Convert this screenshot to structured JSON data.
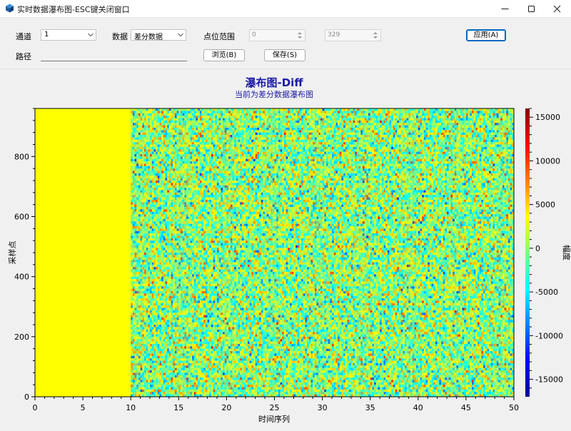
{
  "window": {
    "title": "实时数据瀑布图-ESC键关闭窗口"
  },
  "controls": {
    "channel_label": "通道",
    "channel_value": "1",
    "data_label": "数据",
    "data_value": "差分数据",
    "range_label": "点位范围",
    "range_start": "0",
    "range_end": "329",
    "apply_label": "应用(A)",
    "path_label": "路径",
    "path_value": "",
    "browse_label": "浏览(B)",
    "save_label": "保存(S)"
  },
  "colors": {
    "title": "#1a1aa6",
    "subtitle": "#1a1aa6",
    "base_field": "#ffff00",
    "primary_button_border": "#0067c0"
  },
  "chart_data": {
    "type": "heatmap",
    "title": "瀑布图-Diff",
    "subtitle": "当前为差分数据瀑布图",
    "xlabel": "时间序列",
    "ylabel": "采样点",
    "colorbar_label": "幅度",
    "xlim": [
      0,
      50
    ],
    "ylim": [
      0,
      960
    ],
    "x_ticks": [
      0,
      5,
      10,
      15,
      20,
      25,
      30,
      35,
      40,
      45,
      50
    ],
    "y_ticks": [
      0,
      200,
      400,
      600,
      800
    ],
    "colorbar_range": [
      -17000,
      16000
    ],
    "colorbar_ticks": [
      15000,
      10000,
      5000,
      0,
      -5000,
      -10000,
      -15000
    ],
    "colormap": "jet",
    "columns": 50,
    "rows": 960,
    "zero_columns": [
      0,
      10
    ],
    "noise_amplitude": 4000,
    "grid": false,
    "colorbar_position": "right"
  }
}
